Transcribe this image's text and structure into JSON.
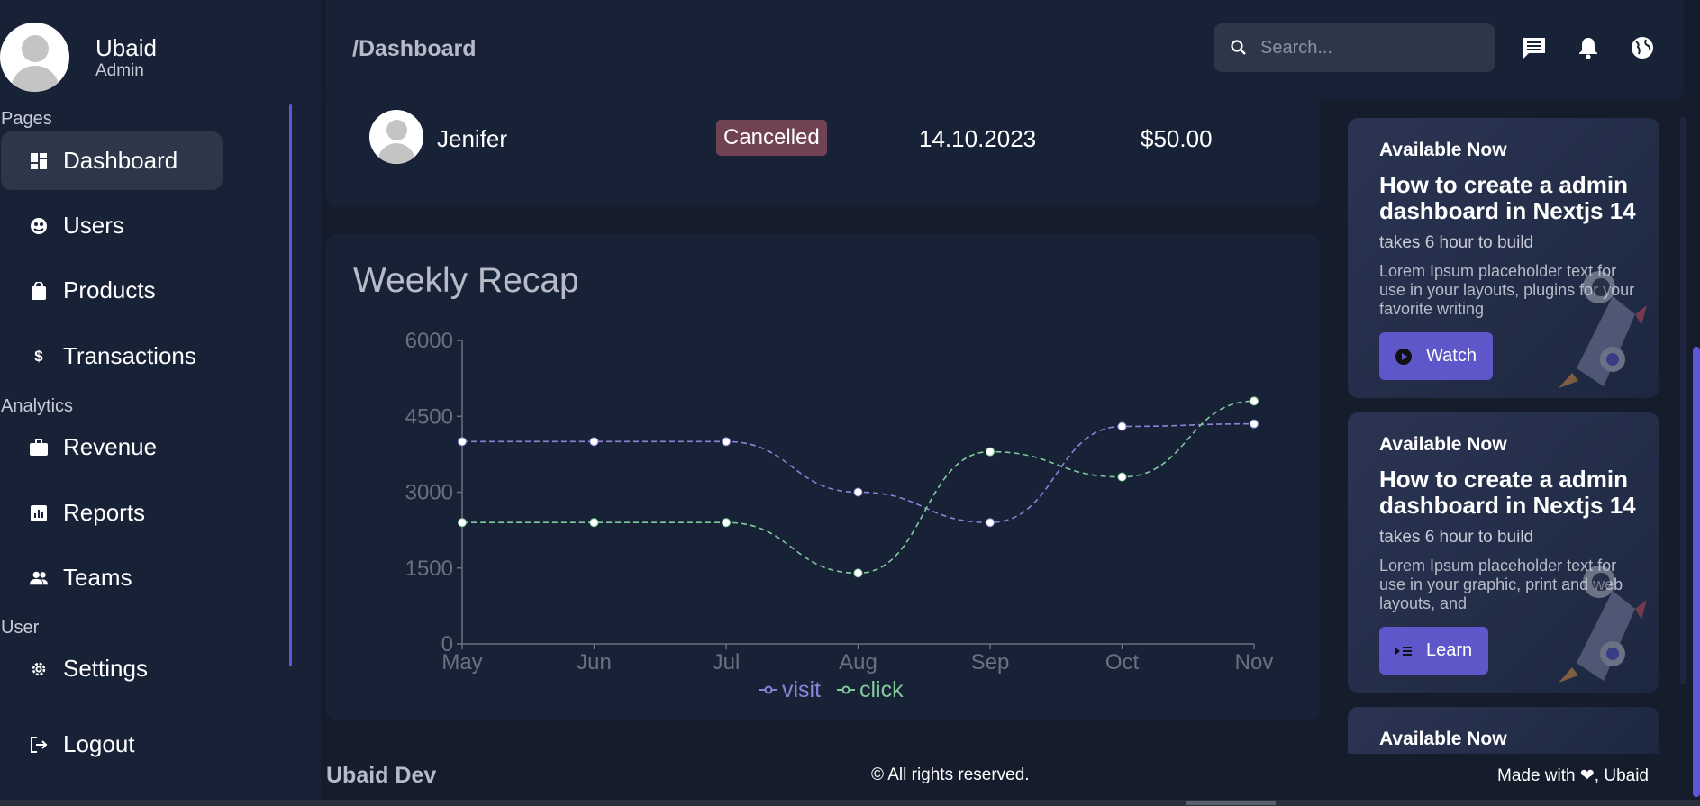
{
  "user": {
    "name": "Ubaid",
    "role": "Admin"
  },
  "sidebar": {
    "sections": [
      {
        "label": "Pages"
      },
      {
        "label": "Analytics"
      },
      {
        "label": "User"
      }
    ],
    "items": [
      {
        "label": "Dashboard",
        "icon": "dashboard-icon"
      },
      {
        "label": "Users",
        "icon": "users-icon"
      },
      {
        "label": "Products",
        "icon": "shopping-bag-icon"
      },
      {
        "label": "Transactions",
        "icon": "dollar-icon"
      },
      {
        "label": "Revenue",
        "icon": "briefcase-icon"
      },
      {
        "label": "Reports",
        "icon": "analytics-icon"
      },
      {
        "label": "Teams",
        "icon": "people-icon"
      },
      {
        "label": "Settings",
        "icon": "gear-icon"
      },
      {
        "label": "Logout",
        "icon": "logout-icon"
      }
    ]
  },
  "navbar": {
    "title": "/Dashboard",
    "search_placeholder": "Search...",
    "icons": [
      "messages-icon",
      "bell-icon",
      "globe-icon"
    ]
  },
  "transaction": {
    "name": "Jenifer",
    "status": "Cancelled",
    "date": "14.10.2023",
    "amount": "$50.00"
  },
  "weekly": {
    "title": "Weekly Recap"
  },
  "chart_data": {
    "type": "line",
    "title": "Weekly Recap",
    "categories": [
      "May",
      "Jun",
      "Jul",
      "Aug",
      "Sep",
      "Oct",
      "Nov"
    ],
    "series": [
      {
        "name": "visit",
        "color": "#8884d8",
        "values": [
          4000,
          4000,
          4000,
          3000,
          2400,
          4300,
          4350
        ]
      },
      {
        "name": "click",
        "color": "#82ca9d",
        "values": [
          2400,
          2400,
          2400,
          1400,
          3800,
          3300,
          4800
        ]
      }
    ],
    "yticks": [
      0,
      1500,
      3000,
      4500,
      6000
    ],
    "ylim": [
      0,
      6000
    ],
    "legend": "bottom-center",
    "grid": false
  },
  "promos": [
    {
      "badge": "Available Now",
      "title": "How to create a admin dashboard in Nextjs 14",
      "subtitle": "takes 6 hour to build",
      "desc": "Lorem Ipsum placeholder text for use in your layouts, plugins for your favorite writing",
      "button": "Watch",
      "button_icon": "play-icon"
    },
    {
      "badge": "Available Now",
      "title": "How to create a admin dashboard in Nextjs 14",
      "subtitle": "takes 6 hour to build",
      "desc": "Lorem Ipsum placeholder text for use in your graphic, print and web layouts, and",
      "button": "Learn",
      "button_icon": "learn-icon"
    },
    {
      "badge": "Available Now"
    }
  ],
  "footer": {
    "brand": "Ubaid Dev",
    "copyright": "© All rights reserved.",
    "made_with": "Made with ❤, Ubaid"
  },
  "colors": {
    "accent": "#5d57c9",
    "bg": "#151c2c",
    "card": "#182237",
    "soft": "#2e374a"
  }
}
